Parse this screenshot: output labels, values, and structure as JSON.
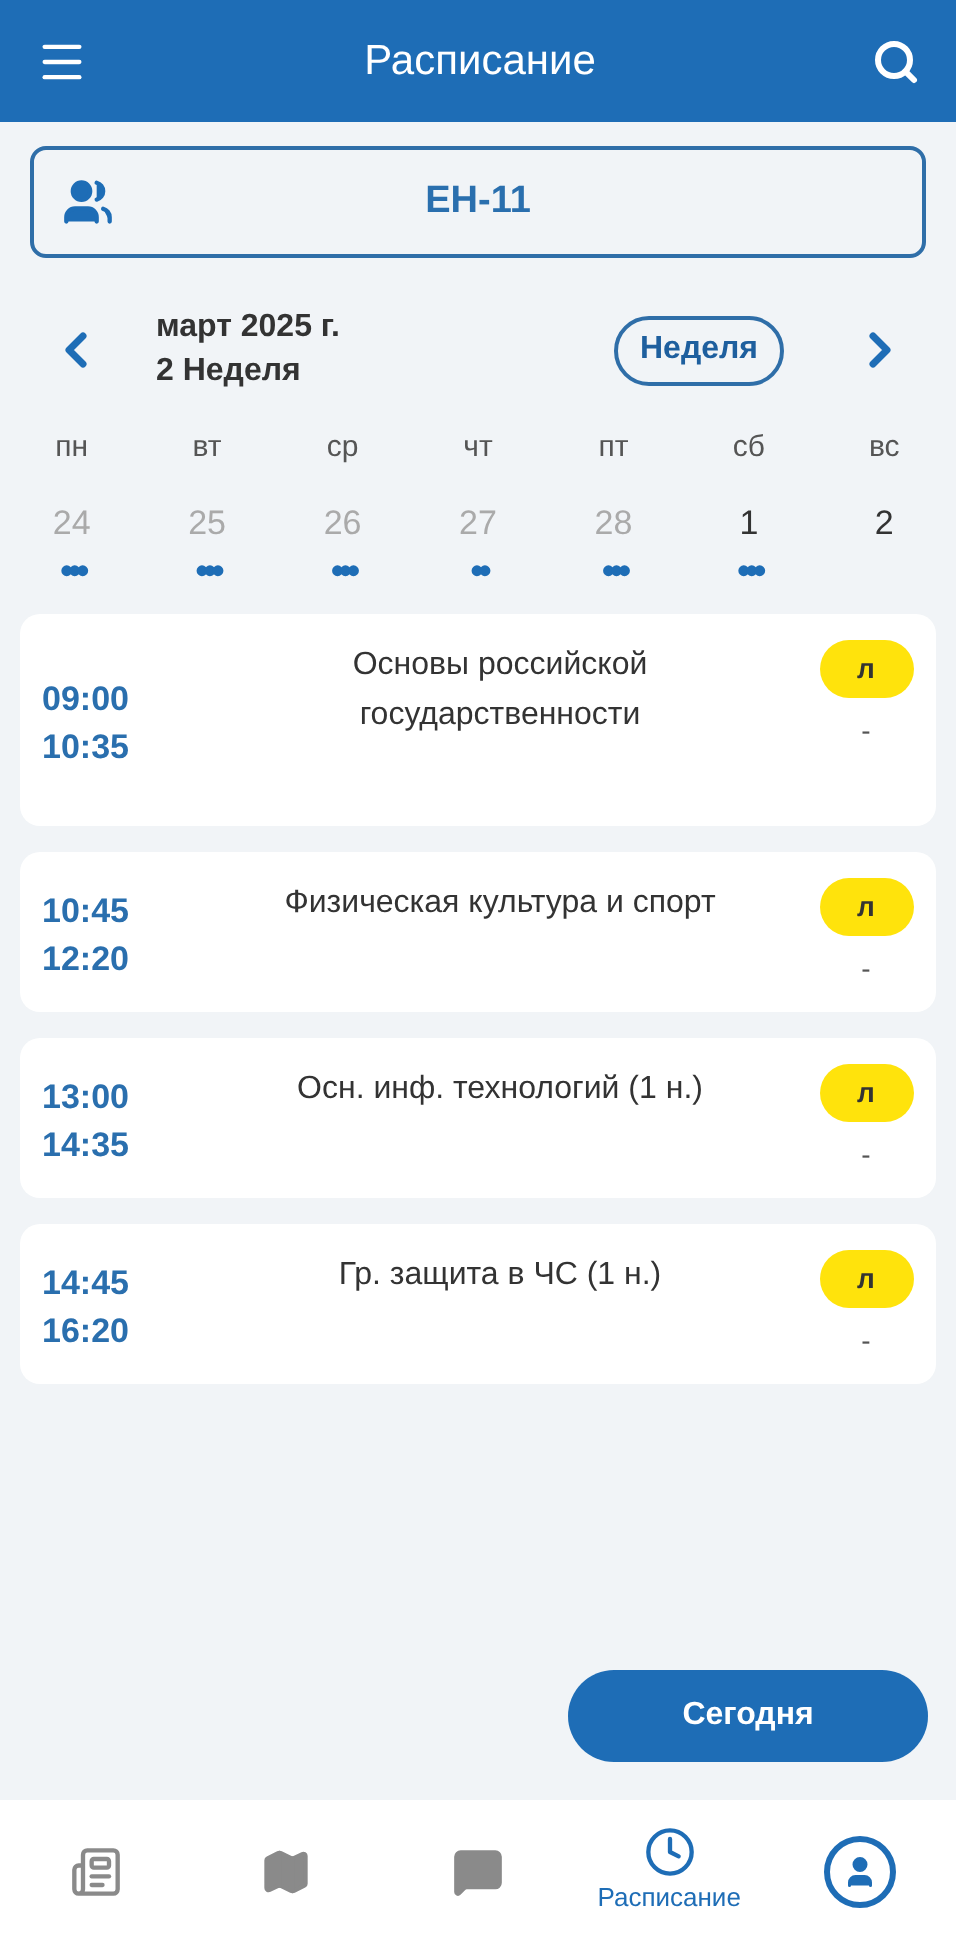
{
  "header": {
    "title": "Расписание"
  },
  "group": {
    "label": "ЕН-11"
  },
  "period": {
    "month": "март 2025 г.",
    "week": "2 Неделя",
    "mode": "Неделя"
  },
  "days": [
    {
      "weekday": "пн",
      "date": "24",
      "muted": true,
      "dots": "•••"
    },
    {
      "weekday": "вт",
      "date": "25",
      "muted": true,
      "dots": "•••"
    },
    {
      "weekday": "ср",
      "date": "26",
      "muted": true,
      "dots": "•••"
    },
    {
      "weekday": "чт",
      "date": "27",
      "muted": true,
      "dots": "••"
    },
    {
      "weekday": "пт",
      "date": "28",
      "muted": true,
      "dots": "•••"
    },
    {
      "weekday": "сб",
      "date": "1",
      "muted": false,
      "dots": "•••"
    },
    {
      "weekday": "вс",
      "date": "2",
      "muted": false
    }
  ],
  "lessons": [
    {
      "start": "09:00",
      "end": "10:35",
      "title": "Основы российской государственности",
      "type": "л",
      "room": "-"
    },
    {
      "start": "10:45",
      "end": "12:20",
      "title": "Физическая культура и спорт",
      "type": "л",
      "room": "-"
    },
    {
      "start": "13:00",
      "end": "14:35",
      "title": "Осн. инф. технологий (1 н.)",
      "type": "л",
      "room": "-"
    },
    {
      "start": "14:45",
      "end": "16:20",
      "title": "Гр. защита в ЧС (1 н.)",
      "type": "л",
      "room": "-"
    }
  ],
  "today_button": "Сегодня",
  "nav": [
    {
      "kind": "news",
      "selected": false
    },
    {
      "kind": "map",
      "selected": false
    },
    {
      "kind": "chat",
      "selected": false
    },
    {
      "kind": "schedule",
      "selected": true,
      "label": "Расписание"
    }
  ]
}
